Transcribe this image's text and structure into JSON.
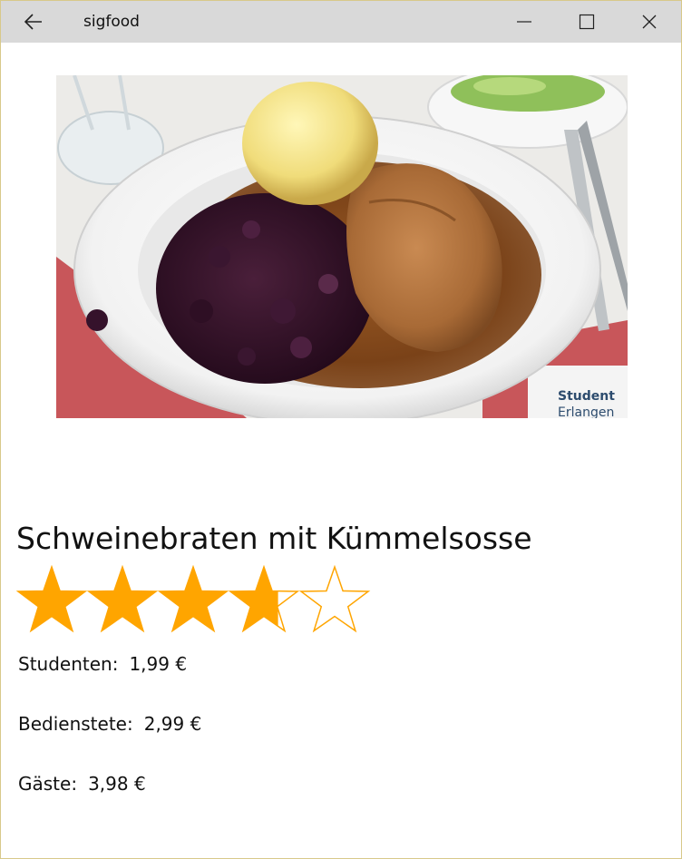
{
  "window": {
    "title": "sigfood"
  },
  "titlebar_icons": {
    "back": "arrow-left-icon",
    "minimize": "minimize-icon",
    "maximize": "maximize-icon",
    "close": "close-icon"
  },
  "dish": {
    "name": "Schweinebraten mit Kümmelsosse",
    "image_subject": "Schweinebraten with red cabbage and potato dumpling on a white plate",
    "rating": {
      "value": 3.7,
      "max": 5
    }
  },
  "prices": [
    {
      "label": "Studenten:",
      "value": "1,99 €"
    },
    {
      "label": "Bedienstete:",
      "value": "2,99 €"
    },
    {
      "label": "Gäste:",
      "value": "3,98 €"
    }
  ],
  "colors": {
    "titlebar": "#d9d9d9",
    "star": "#ffa500",
    "window_border": "#d8c98a"
  }
}
